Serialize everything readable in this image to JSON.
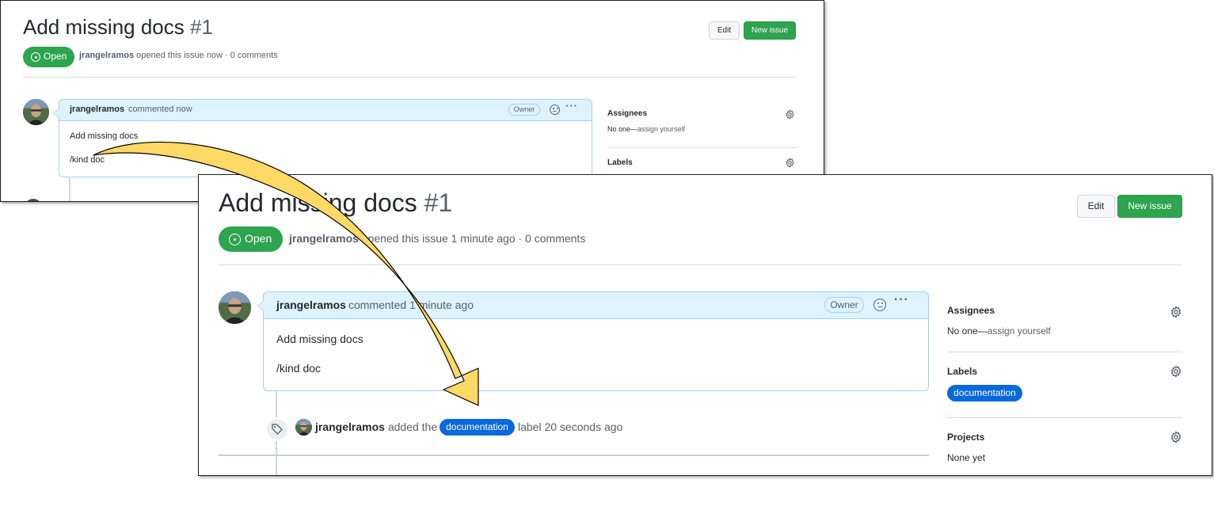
{
  "back": {
    "title": "Add missing docs",
    "number": "#1",
    "edit_label": "Edit",
    "new_issue_label": "New issue",
    "state_label": "Open",
    "meta_author": "jrangelramos",
    "meta_rest": "opened this issue now · 0 comments",
    "comment": {
      "author": "jrangelramos",
      "time": "commented now",
      "badge": "Owner",
      "body_line1": "Add missing docs",
      "body_line2": "/kind doc"
    },
    "sidebar": {
      "assignees_title": "Assignees",
      "assignees_none": "No one—",
      "assignees_link": "assign yourself",
      "labels_title": "Labels"
    }
  },
  "front": {
    "title": "Add missing docs",
    "number": "#1",
    "edit_label": "Edit",
    "new_issue_label": "New issue",
    "state_label": "Open",
    "meta_author": "jrangelramos",
    "meta_rest": "opened this issue 1 minute ago · 0 comments",
    "comment": {
      "author": "jrangelramos",
      "time": "commented 1 minute ago",
      "badge": "Owner",
      "body_line1": "Add missing docs",
      "body_line2": "/kind doc"
    },
    "event": {
      "author": "jrangelramos",
      "action": "added the",
      "label": "documentation",
      "suffix": "label 20 seconds ago"
    },
    "sidebar": {
      "assignees_title": "Assignees",
      "assignees_none": "No one—",
      "assignees_link": "assign yourself",
      "labels_title": "Labels",
      "label": "documentation",
      "projects_title": "Projects",
      "projects_value": "None yet"
    }
  },
  "colors": {
    "open_green": "#2da44e",
    "label_blue": "#0969da",
    "comment_header": "#ddf4ff",
    "arrow_fill": "#ffd966"
  },
  "icons": [
    "issue-opened-icon",
    "smiley-icon",
    "kebab-horizontal-icon",
    "gear-icon",
    "tag-icon",
    "curved-arrow"
  ]
}
